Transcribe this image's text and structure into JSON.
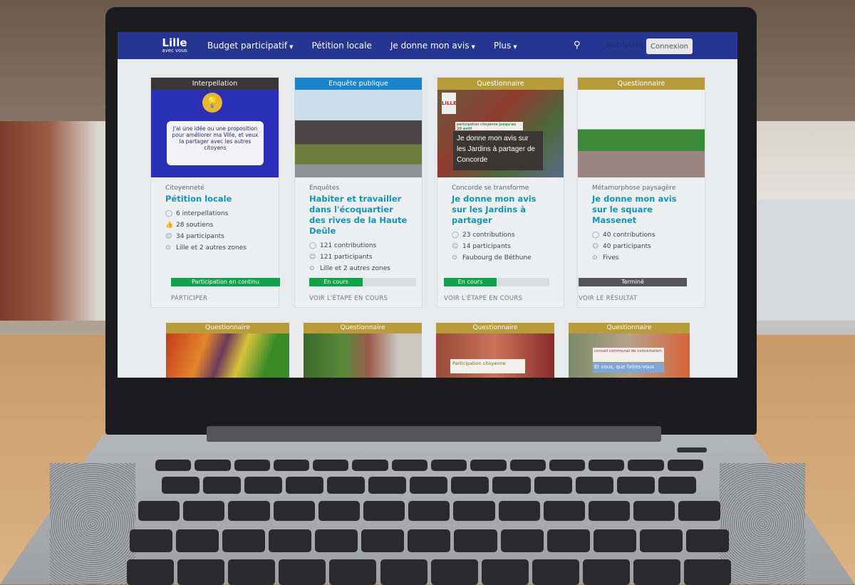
{
  "navbar": {
    "logo_main": "Lille",
    "logo_sub": "avec vous",
    "items": [
      {
        "label": "Budget participatif",
        "dropdown": true
      },
      {
        "label": "Pétition locale",
        "dropdown": false
      },
      {
        "label": "Je donne mon avis",
        "dropdown": true
      },
      {
        "label": "Plus",
        "dropdown": true
      }
    ],
    "search_icon": "search-icon",
    "signup_label": "Inscription",
    "login_label": "Connexion",
    "color": "#24368f"
  },
  "cards": [
    {
      "tag": "Interpellation",
      "tag_color": "#3b3534",
      "image_text": "J'ai une idée ou une proposition pour améliorer ma Ville, et veux la partager avec les autres citoyens",
      "theme": "Citoyenneté",
      "title": "Pétition locale",
      "stats": [
        {
          "icon": "comment-icon",
          "text": "6 interpellations"
        },
        {
          "icon": "thumbs-up-icon",
          "text": "28 soutiens"
        },
        {
          "icon": "user-icon",
          "text": "34 participants"
        },
        {
          "icon": "location-icon",
          "text": "Lille et 2 autres zones"
        }
      ],
      "status": "Participation en continu",
      "status_color": "#12a24b",
      "progress": 100,
      "action": "PARTICIPER"
    },
    {
      "tag": "Enquête publique",
      "tag_color": "#1a84cc",
      "theme": "Enquêtes",
      "title": "Habiter et travailler dans l'écoquartier des rives de la Haute Deûle",
      "stats": [
        {
          "icon": "comment-icon",
          "text": "121 contributions"
        },
        {
          "icon": "user-icon",
          "text": "121 participants"
        },
        {
          "icon": "location-icon",
          "text": "Lille et 2 autres zones"
        }
      ],
      "status": "En cours",
      "status_color": "#12a24b",
      "progress": 50,
      "action": "VOIR L'ÉTAPE EN COURS"
    },
    {
      "tag": "Questionnaire",
      "tag_color": "#b89c3c",
      "image_text": "Je donne mon avis sur les Jardins à partager de Concorde",
      "image_badge": "participation citoyenne",
      "image_date": "jusqu'au 20 avril",
      "theme": "Concorde se transforme",
      "title": "Je donne mon avis sur les Jardins à partager",
      "stats": [
        {
          "icon": "comment-icon",
          "text": "23 contributions"
        },
        {
          "icon": "user-icon",
          "text": "14 participants"
        },
        {
          "icon": "location-icon",
          "text": "Faubourg de Béthune"
        }
      ],
      "status": "En cours",
      "status_color": "#12a24b",
      "progress": 50,
      "action": "VOIR L'ÉTAPE EN COURS"
    },
    {
      "tag": "Questionnaire",
      "tag_color": "#b89c3c",
      "theme": "Métamorphose paysagère",
      "title": "Je donne mon avis sur le square Massenet",
      "stats": [
        {
          "icon": "comment-icon",
          "text": "40 contributions"
        },
        {
          "icon": "user-icon",
          "text": "40 participants"
        },
        {
          "icon": "location-icon",
          "text": "Fives"
        }
      ],
      "status": "Terminé",
      "status_color": "#555558",
      "progress": 100,
      "action": "VOIR LE RÉSULTAT"
    }
  ],
  "cards_row2": [
    {
      "tag": "Questionnaire"
    },
    {
      "tag": "Questionnaire"
    },
    {
      "tag": "Questionnaire",
      "image_text": "Participation citoyenne"
    },
    {
      "tag": "Questionnaire",
      "image_text": "conseil communal de concertation",
      "image_text2": "Et vous, que faites-vous"
    }
  ]
}
